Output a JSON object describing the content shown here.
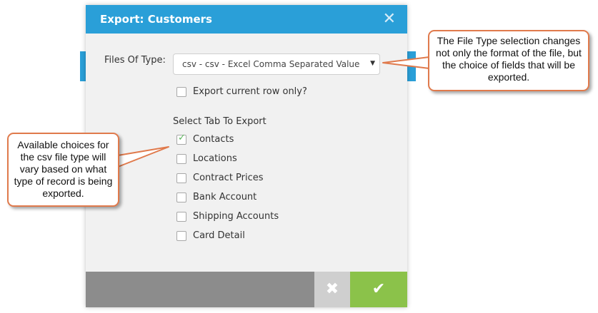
{
  "dialog": {
    "title": "Export: Customers",
    "close_glyph": "✕",
    "files_of_type_label": "Files Of Type:",
    "file_type_value": "csv - csv - Excel Comma Separated Value",
    "export_row_only_label": "Export current row only?",
    "select_tab_label": "Select Tab To Export",
    "tabs": [
      {
        "label": "Contacts",
        "checked": true
      },
      {
        "label": "Locations",
        "checked": false
      },
      {
        "label": "Contract Prices",
        "checked": false
      },
      {
        "label": "Bank Account",
        "checked": false
      },
      {
        "label": "Shipping Accounts",
        "checked": false
      },
      {
        "label": "Card Detail",
        "checked": false
      }
    ],
    "cancel_glyph": "✖",
    "ok_glyph": "✔"
  },
  "callouts": {
    "file_type_note": "The File Type selection changes not only the format of the file, but the choice of fields that will be exported.",
    "choices_note": "Available choices for the csv file type will vary based on what type of record is being exported."
  },
  "icons": {
    "close": "close-icon",
    "dropdown": "chevron-down-icon",
    "cancel": "x-icon",
    "ok": "checkmark-icon"
  },
  "colors": {
    "header": "#2a9fd8",
    "ok_button": "#8bc24a",
    "cancel_button": "#cfcfcf",
    "callout_border": "#e07a4c",
    "check": "#5bb85b"
  }
}
